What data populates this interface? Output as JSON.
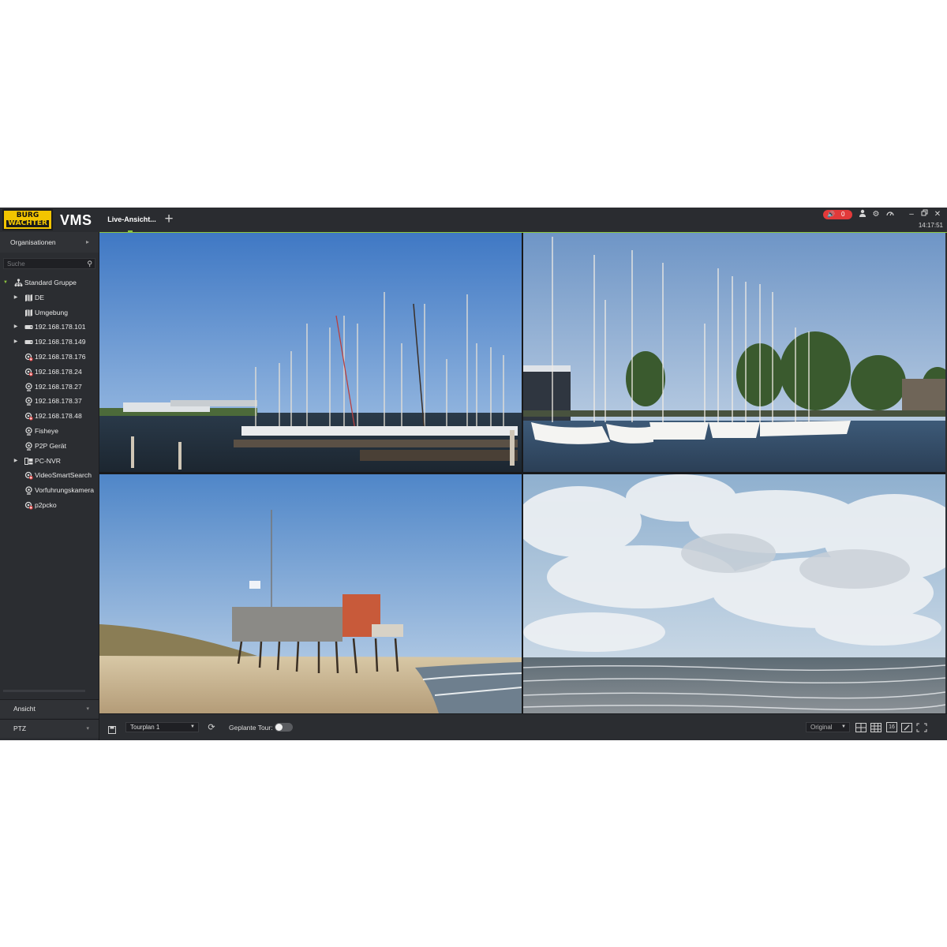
{
  "header": {
    "logo_line1": "BURG",
    "logo_line2": "WÄCHTER",
    "app_name": "VMS",
    "tab_label": "Live-Ansicht...",
    "add_tab": "+",
    "alarm_count": "0",
    "clock": "14:17:51"
  },
  "sidebar": {
    "header": "Organisationen",
    "search_placeholder": "Suche",
    "tree": [
      {
        "label": "Standard Gruppe",
        "icon": "group-icon",
        "expand": "expanded"
      },
      {
        "label": "DE",
        "icon": "map-icon",
        "expand": "collapsed"
      },
      {
        "label": "Umgebung",
        "icon": "map-icon",
        "expand": ""
      },
      {
        "label": "192.168.178.101",
        "icon": "nvr-device-icon",
        "expand": "collapsed"
      },
      {
        "label": "192.168.178.149",
        "icon": "nvr-device-icon",
        "expand": "collapsed"
      },
      {
        "label": "192.168.178.176",
        "icon": "camera-offline-icon",
        "expand": ""
      },
      {
        "label": "192.168.178.24",
        "icon": "camera-offline-icon",
        "expand": ""
      },
      {
        "label": "192.168.178.27",
        "icon": "camera-icon",
        "expand": ""
      },
      {
        "label": "192.168.178.37",
        "icon": "camera-icon",
        "expand": ""
      },
      {
        "label": "192.168.178.48",
        "icon": "camera-offline-icon",
        "expand": ""
      },
      {
        "label": "Fisheye",
        "icon": "camera-icon",
        "expand": ""
      },
      {
        "label": "P2P Gerät",
        "icon": "camera-icon",
        "expand": ""
      },
      {
        "label": "PC-NVR",
        "icon": "pc-nvr-icon",
        "expand": "collapsed"
      },
      {
        "label": "VideoSmartSearch",
        "icon": "camera-offline-icon",
        "expand": ""
      },
      {
        "label": "Vorfuhrungskamera",
        "icon": "camera-icon",
        "expand": ""
      },
      {
        "label": "p2pcko",
        "icon": "camera-offline-icon",
        "expand": ""
      }
    ],
    "bottom_sections": [
      "Ansicht",
      "PTZ"
    ]
  },
  "toolbar": {
    "tour_value": "Tourplan 1",
    "tour_label": "Geplante Tour:",
    "scale_value": "Original",
    "layout_16_label": "16"
  },
  "colors": {
    "accent": "#8ec63f",
    "alarm": "#e23a3a",
    "logo_yellow": "#f2c500"
  }
}
